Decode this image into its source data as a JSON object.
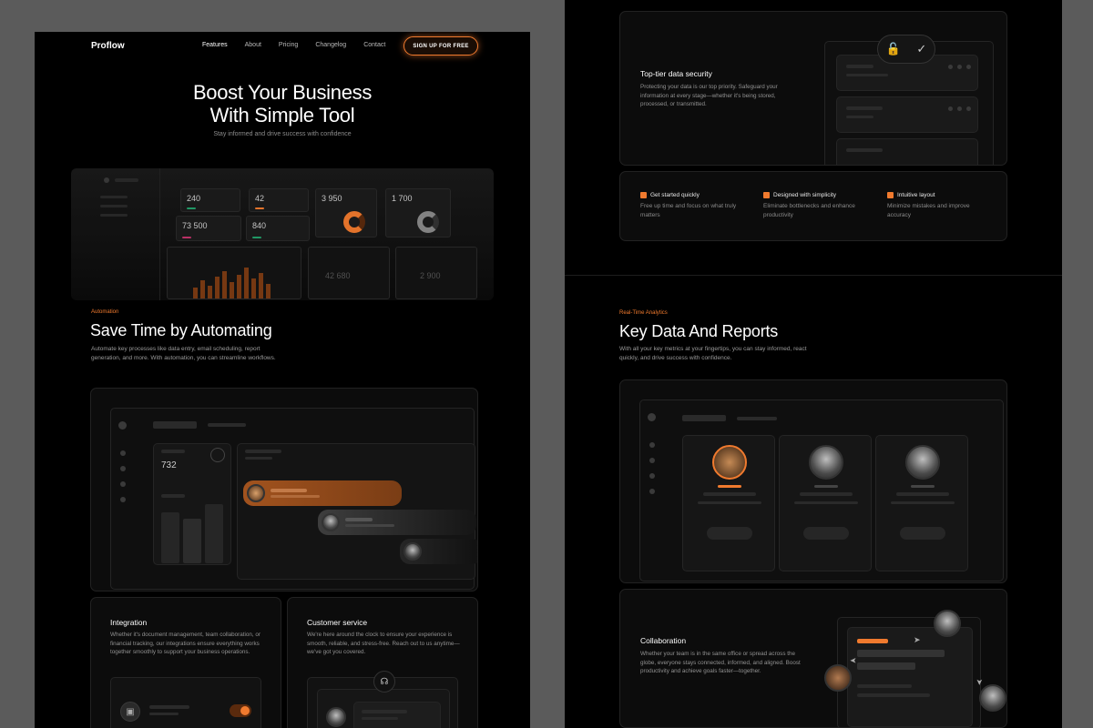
{
  "nav": {
    "brand": "Proflow",
    "links": [
      "Features",
      "About",
      "Pricing",
      "Changelog",
      "Contact"
    ],
    "cta": "SIGN UP FOR FREE"
  },
  "hero": {
    "title_line1": "Boost Your Business",
    "title_line2": "With Simple Tool",
    "subtitle": "Stay informed and drive success with confidence"
  },
  "dashboard": {
    "tiles": [
      "240",
      "42",
      "3 950",
      "1 700",
      "73 500",
      "840"
    ],
    "bottom": [
      "42 680",
      "2 900"
    ]
  },
  "automation": {
    "eyebrow": "Automation",
    "title": "Save Time by Automating",
    "desc": "Automate key processes like data entry, email scheduling, report generation, and more. With automation, you can streamline workflows.",
    "metric": "732"
  },
  "integration": {
    "title": "Integration",
    "desc": "Whether it's document management, team collaboration, or financial tracking, our integrations ensure everything works together smoothly to support your business operations."
  },
  "customer": {
    "title": "Customer service",
    "desc": "We're here around the clock to ensure your experience is smooth, reliable, and stress-free. Reach out to us anytime—we've got you covered."
  },
  "security": {
    "title": "Top-tier data security",
    "desc": "Protecting your data is our top priority. Safeguard your information at every stage—whether it's being stored, processed, or transmitted."
  },
  "features": [
    {
      "icon": "fire-icon",
      "title": "Get started quickly",
      "desc": "Free up time and focus on what truly matters"
    },
    {
      "icon": "brush-icon",
      "title": "Designed with simplicity",
      "desc": "Eliminate bottlenecks and enhance productivity"
    },
    {
      "icon": "calendar-icon",
      "title": "Intuitive layout",
      "desc": "Minimize mistakes and improve accuracy"
    }
  ],
  "analytics": {
    "eyebrow": "Real-Time Analytics",
    "title": "Key Data And Reports",
    "desc": "With all your key metrics at your fingertips, you can stay informed, react quickly, and drive success with confidence."
  },
  "collab": {
    "title": "Collaboration",
    "desc": "Whether your team is in the same office or spread across the globe, everyone stays connected, informed, and aligned. Boost productivity and achieve goals faster—together."
  },
  "colors": {
    "accent": "#f07a2e",
    "bg": "#000000"
  }
}
